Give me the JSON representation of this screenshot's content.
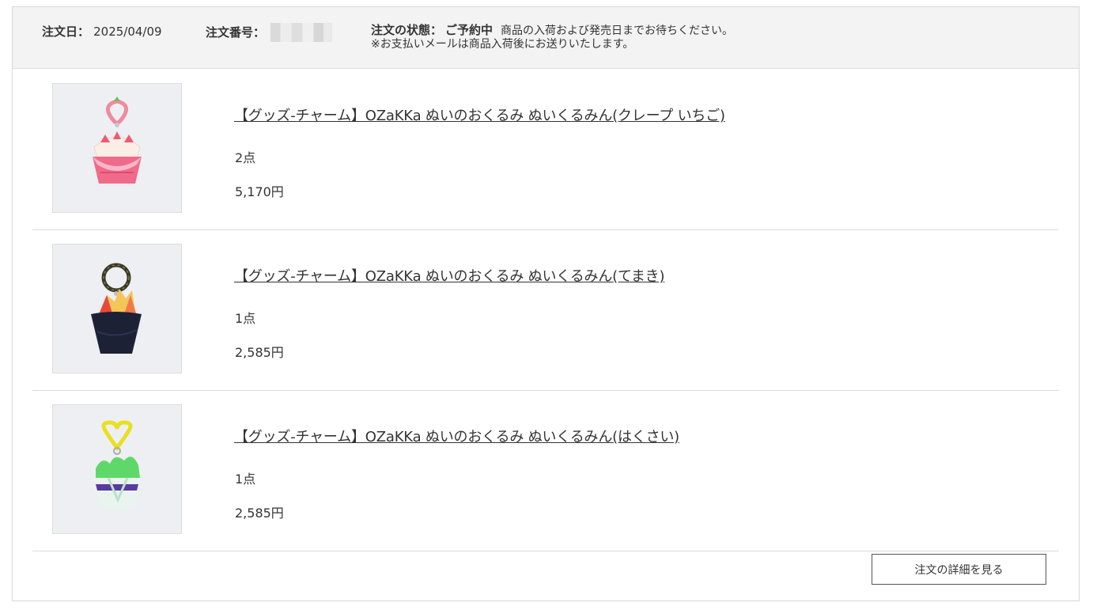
{
  "header": {
    "order_date_label": "注文日：",
    "order_date": "2025/04/09",
    "order_number_label": "注文番号：",
    "status_label": "注文の状態：",
    "status_value": "ご予約中",
    "status_note_line1": "商品の入荷および発売日までお待ちください。",
    "status_note_line2": "※お支払いメールは商品入荷後にお送りいたします。"
  },
  "items": [
    {
      "title": "【グッズ-チャーム】OZaKKa ぬいのおくるみ ぬいくるみん(クレープ いちご)",
      "quantity": "2点",
      "price": "5,170円",
      "image_icon": "crepe-strawberry-charm-image"
    },
    {
      "title": "【グッズ-チャーム】OZaKKa ぬいのおくるみ ぬいくるみん(てまき)",
      "quantity": "1点",
      "price": "2,585円",
      "image_icon": "temaki-charm-image"
    },
    {
      "title": "【グッズ-チャーム】OZaKKa ぬいのおくるみ ぬいくるみん(はくさい)",
      "quantity": "1点",
      "price": "2,585円",
      "image_icon": "hakusai-charm-image"
    }
  ],
  "actions": {
    "view_details_label": "注文の詳細を見る"
  },
  "colors": {
    "header_bg": "#f3f3f3",
    "thumb_bg": "#eeeff3",
    "border": "#dddddd"
  }
}
